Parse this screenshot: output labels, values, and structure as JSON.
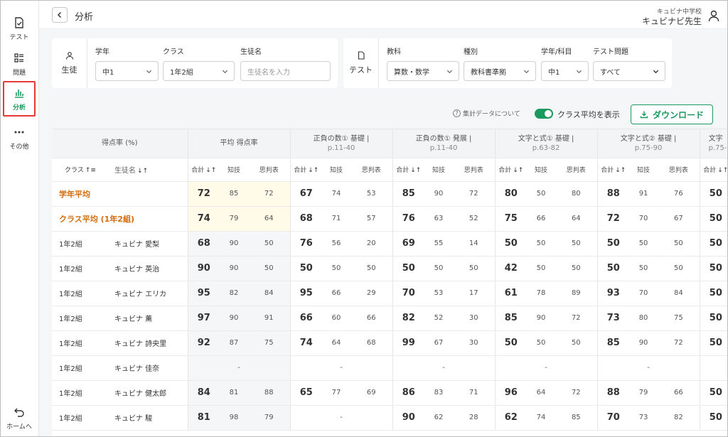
{
  "sidebar": {
    "items": [
      {
        "label": "テスト",
        "icon": "test-check-icon",
        "active": false
      },
      {
        "label": "問題",
        "icon": "problem-list-icon",
        "active": false
      },
      {
        "label": "分析",
        "icon": "analysis-chart-icon",
        "active": true
      },
      {
        "label": "その他",
        "icon": "more-dots-icon",
        "active": false
      }
    ],
    "home_label": "ホームへ"
  },
  "header": {
    "title": "分析",
    "school": "キュビナ中学校",
    "teacher": "キュビナビ先生"
  },
  "student_filter": {
    "title": "生徒",
    "grade_label": "学年",
    "grade_value": "中1",
    "class_label": "クラス",
    "class_value": "1年2組",
    "name_label": "生徒名",
    "name_placeholder": "生徒名を入力"
  },
  "test_filter": {
    "title": "テスト",
    "subject_label": "教科",
    "subject_value": "算数・数学",
    "type_label": "種別",
    "type_value": "教科書準拠",
    "grade_subject_label": "学年/科目",
    "grade_subject_value": "中1",
    "question_label": "テスト問題",
    "question_value": "すべて"
  },
  "options": {
    "about_aggregate": "集計データについて",
    "show_class_avg_label": "クラス平均を表示",
    "show_class_avg": true,
    "download_label": "ダウンロード"
  },
  "colors": {
    "accent": "#1a9a5c",
    "average_text": "#d46b08",
    "active_outline": "#e53935"
  },
  "table": {
    "corner_label": "得点率 (%)",
    "class_header": "クラス",
    "name_header": "生徒名",
    "groups": [
      {
        "title": "平均 得点率",
        "sub": ""
      },
      {
        "title": "正負の数① 基礎 |",
        "sub": "p.11-40"
      },
      {
        "title": "正負の数① 発展 |",
        "sub": "p.11-40"
      },
      {
        "title": "文字と式① 基礎 |",
        "sub": "p.63-82"
      },
      {
        "title": "文字と式② 基礎 |",
        "sub": "p.75-90"
      },
      {
        "title": "文字",
        "sub": "p.75-"
      }
    ],
    "sub_headers": {
      "total": "合計",
      "knowledge": "知技",
      "thinking": "思判表"
    },
    "rows": [
      {
        "kind": "avg",
        "cls": "学年平均",
        "name": "",
        "cells": [
          [
            "72",
            "85",
            "72"
          ],
          [
            "67",
            "74",
            "53"
          ],
          [
            "85",
            "90",
            "72"
          ],
          [
            "80",
            "50",
            "80"
          ],
          [
            "88",
            "91",
            "76"
          ],
          [
            "50",
            "",
            ""
          ]
        ]
      },
      {
        "kind": "avg",
        "cls": "クラス平均 (1年2組)",
        "name": "",
        "cells": [
          [
            "74",
            "79",
            "64"
          ],
          [
            "68",
            "71",
            "57"
          ],
          [
            "76",
            "63",
            "52"
          ],
          [
            "75",
            "66",
            "64"
          ],
          [
            "72",
            "70",
            "67"
          ],
          [
            "50",
            "",
            ""
          ]
        ]
      },
      {
        "kind": "student",
        "cls": "1年2組",
        "name": "キュビナ 愛梨",
        "cells": [
          [
            "68",
            "90",
            "50"
          ],
          [
            "76",
            "56",
            "20"
          ],
          [
            "69",
            "55",
            "14"
          ],
          [
            "50",
            "50",
            "50"
          ],
          [
            "50",
            "50",
            "50"
          ],
          [
            "50",
            "",
            ""
          ]
        ]
      },
      {
        "kind": "student",
        "cls": "1年2組",
        "name": "キュビナ 英治",
        "cells": [
          [
            "90",
            "90",
            "50"
          ],
          [
            "50",
            "50",
            "50"
          ],
          [
            "50",
            "50",
            "50"
          ],
          [
            "42",
            "50",
            "50"
          ],
          [
            "50",
            "50",
            "50"
          ],
          [
            "50",
            "",
            ""
          ]
        ]
      },
      {
        "kind": "student",
        "cls": "1年2組",
        "name": "キュビナ エリカ",
        "cells": [
          [
            "95",
            "82",
            "84"
          ],
          [
            "95",
            "66",
            "29"
          ],
          [
            "70",
            "53",
            "17"
          ],
          [
            "61",
            "78",
            "89"
          ],
          [
            "93",
            "70",
            "84"
          ],
          [
            "50",
            "",
            ""
          ]
        ]
      },
      {
        "kind": "student",
        "cls": "1年2組",
        "name": "キュビナ 薫",
        "cells": [
          [
            "97",
            "90",
            "91"
          ],
          [
            "66",
            "60",
            "66"
          ],
          [
            "82",
            "52",
            "30"
          ],
          [
            "85",
            "90",
            "72"
          ],
          [
            "73",
            "80",
            "75"
          ],
          [
            "50",
            "",
            ""
          ]
        ]
      },
      {
        "kind": "student",
        "cls": "1年2組",
        "name": "キュビナ 詩央里",
        "cells": [
          [
            "92",
            "87",
            "75"
          ],
          [
            "74",
            "64",
            "68"
          ],
          [
            "99",
            "67",
            "30"
          ],
          [
            "50",
            "50",
            "50"
          ],
          [
            "85",
            "90",
            "72"
          ],
          [
            "50",
            "",
            ""
          ]
        ]
      },
      {
        "kind": "student",
        "cls": "1年2組",
        "name": "キュビナ 佳奈",
        "cells": [
          [
            "",
            "-",
            ""
          ],
          [
            "",
            "-",
            ""
          ],
          [
            "",
            "-",
            ""
          ],
          [
            "",
            "-",
            ""
          ],
          [
            "",
            "-",
            ""
          ],
          [
            "",
            "",
            ""
          ]
        ]
      },
      {
        "kind": "student",
        "cls": "1年2組",
        "name": "キュビナ 健太郎",
        "cells": [
          [
            "84",
            "81",
            "88"
          ],
          [
            "65",
            "77",
            "69"
          ],
          [
            "86",
            "83",
            "71"
          ],
          [
            "96",
            "64",
            "72"
          ],
          [
            "88",
            "79",
            "66"
          ],
          [
            "50",
            "",
            ""
          ]
        ]
      },
      {
        "kind": "student",
        "cls": "1年2組",
        "name": "キュビナ 駿",
        "cells": [
          [
            "81",
            "98",
            "79"
          ],
          [
            "",
            "-",
            ""
          ],
          [
            "90",
            "62",
            "28"
          ],
          [
            "62",
            "74",
            "85"
          ],
          [
            "70",
            "73",
            "82"
          ],
          [
            "50",
            "",
            ""
          ]
        ]
      }
    ]
  }
}
